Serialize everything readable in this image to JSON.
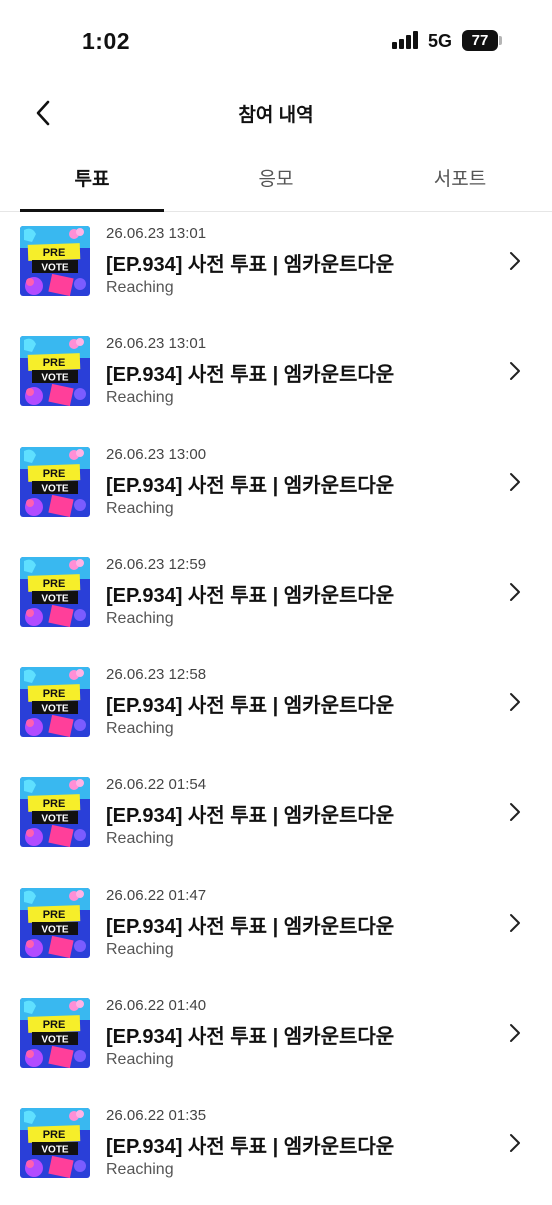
{
  "status": {
    "time": "1:02",
    "network": "5G",
    "battery": "77"
  },
  "header": {
    "title": "참여 내역",
    "back_icon": "chevron-left-icon"
  },
  "tabs": [
    {
      "label": "투표",
      "active": true
    },
    {
      "label": "응모",
      "active": false
    },
    {
      "label": "서포트",
      "active": false
    }
  ],
  "thumbnail": {
    "line1": "PRE",
    "line2": "VOTE"
  },
  "items": [
    {
      "date": "26.06.23 13:01",
      "title": "[EP.934] 사전 투표 | 엠카운트다운",
      "subtitle": "Reaching"
    },
    {
      "date": "26.06.23 13:01",
      "title": "[EP.934] 사전 투표 | 엠카운트다운",
      "subtitle": "Reaching"
    },
    {
      "date": "26.06.23 13:00",
      "title": "[EP.934] 사전 투표 | 엠카운트다운",
      "subtitle": "Reaching"
    },
    {
      "date": "26.06.23 12:59",
      "title": "[EP.934] 사전 투표 | 엠카운트다운",
      "subtitle": "Reaching"
    },
    {
      "date": "26.06.23 12:58",
      "title": "[EP.934] 사전 투표 | 엠카운트다운",
      "subtitle": "Reaching"
    },
    {
      "date": "26.06.22 01:54",
      "title": "[EP.934] 사전 투표 | 엠카운트다운",
      "subtitle": "Reaching"
    },
    {
      "date": "26.06.22 01:47",
      "title": "[EP.934] 사전 투표 | 엠카운트다운",
      "subtitle": "Reaching"
    },
    {
      "date": "26.06.22 01:40",
      "title": "[EP.934] 사전 투표 | 엠카운트다운",
      "subtitle": "Reaching"
    },
    {
      "date": "26.06.22 01:35",
      "title": "[EP.934] 사전 투표 | 엠카운트다운",
      "subtitle": "Reaching"
    }
  ]
}
